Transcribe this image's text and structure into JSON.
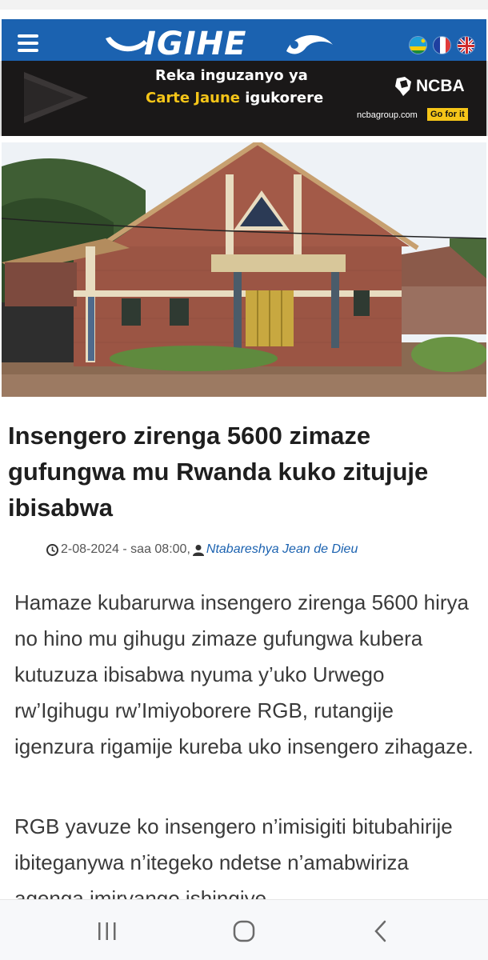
{
  "header": {
    "logo_text": "IGIHE",
    "menu_icon": "hamburger-menu-icon",
    "languages": [
      "Kinyarwanda",
      "Français",
      "English"
    ],
    "brand_color": "#1b62b0"
  },
  "ad": {
    "line1": "Reka inguzanyo ya",
    "line2_highlight": "Carte Jaune",
    "line2_rest": " igukorere",
    "brand": "NCBA",
    "url": "ncbagroup.com",
    "cta": "Go for it"
  },
  "article": {
    "title": "Insengero zirenga 5600 zimaze gufungwa mu Rwanda kuko zitujuje ibisabwa",
    "date": "2-08-2024 - saa 08:00,",
    "author": "Ntabareshya Jean de Dieu",
    "paragraphs": [
      "Hamaze kubarurwa insengero zirenga 5600 hirya no hino mu gihugu zimaze gufungwa kubera kutuzuza ibisabwa nyuma y’uko Urwego rw’Igihugu rw’Imiyoborere RGB, rutangije igenzura rigamije kureba uko insengero zihagaze.",
      "RGB yavuze ko insengero n’imisigiti bitubahirije ibiteganywa n’itegeko ndetse n’amabwiriza agenga imiryango ishingiye"
    ]
  },
  "navbar": {
    "icons": [
      "recent-apps-icon",
      "home-icon",
      "back-icon"
    ]
  }
}
